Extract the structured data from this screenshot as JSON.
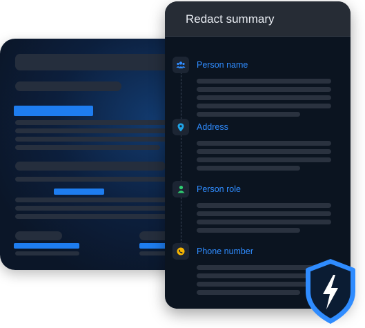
{
  "summary_panel": {
    "title": "Redact summary",
    "sections": [
      {
        "label": "Person name",
        "icon": "people-icon",
        "color": "#2f8cff"
      },
      {
        "label": "Address",
        "icon": "location-pin-icon",
        "color": "#1fa3e6"
      },
      {
        "label": "Person role",
        "icon": "person-icon",
        "color": "#2ecc71"
      },
      {
        "label": "Phone number",
        "icon": "phone-icon",
        "color": "#f5b400"
      }
    ]
  },
  "colors": {
    "accent": "#2f8cff",
    "highlight": "#1e7df0",
    "shield_outline": "#2f8cff"
  },
  "badge": {
    "icon": "shield-lightning-icon"
  }
}
